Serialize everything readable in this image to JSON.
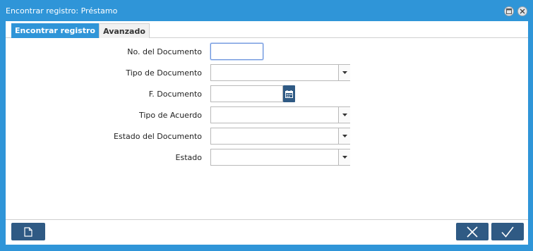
{
  "window": {
    "title": "Encontrar registro: Préstamo",
    "accent": "#2f95d8",
    "dark_button": "#2f5a84"
  },
  "tabs": [
    {
      "label": "Encontrar registro",
      "active": true
    },
    {
      "label": "Avanzado",
      "active": false
    }
  ],
  "form": {
    "fields": [
      {
        "label": "No. del Documento",
        "type": "text",
        "value": ""
      },
      {
        "label": "Tipo de Documento",
        "type": "select",
        "value": ""
      },
      {
        "label": "F. Documento",
        "type": "date",
        "value": ""
      },
      {
        "label": "Tipo de Acuerdo",
        "type": "select",
        "value": ""
      },
      {
        "label": "Estado del Documento",
        "type": "select",
        "value": ""
      },
      {
        "label": "Estado",
        "type": "select",
        "value": ""
      }
    ]
  },
  "icons": {
    "maximize": "window-icon",
    "close": "close-icon",
    "dropdown": "chevron-down-icon",
    "calendar": "calendar-icon",
    "new": "new-document-icon",
    "cancel": "x-icon",
    "ok": "check-icon"
  }
}
